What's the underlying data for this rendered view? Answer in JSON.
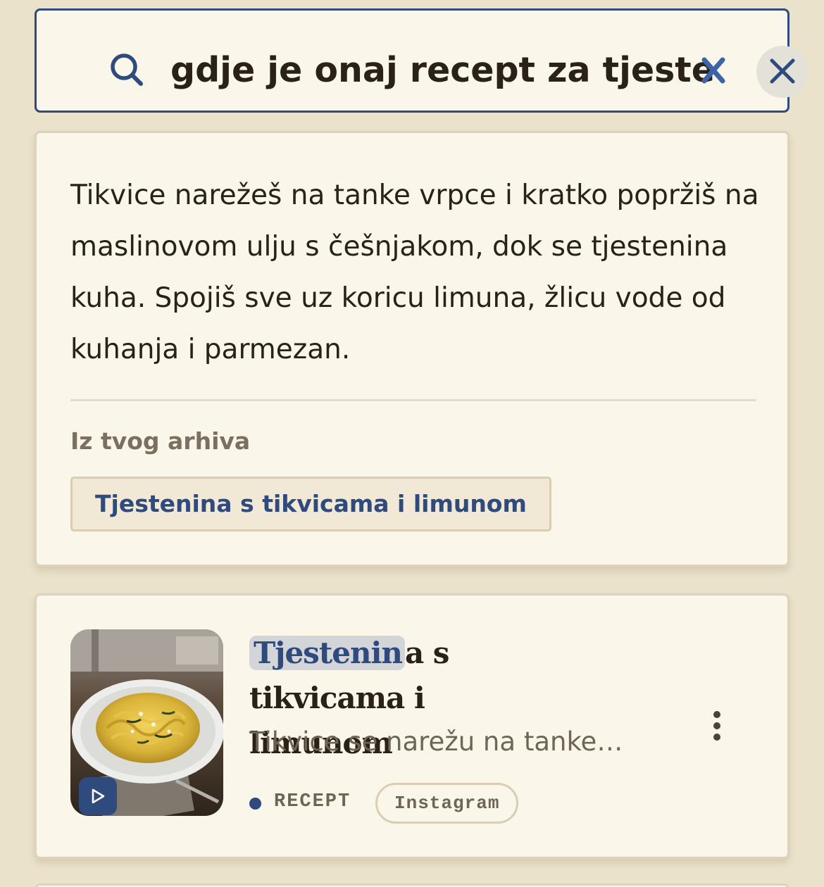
{
  "search": {
    "query": "gdje je onaj recept za tjestenin",
    "icon": "search-icon",
    "inline_clear_icon": "close-icon",
    "clear_button_icon": "close-icon"
  },
  "answer": {
    "text": "Tikvice narežeš na tanke vrpce i kratko popržiš na maslinovom ulju s češnjakom, dok se tjestenina kuha. Spojiš sve uz koricu limuna, žlicu vode od kuhanja i parmezan.",
    "archive_label": "Iz tvog arhiva",
    "archive_link": "Tjestenina s tikvicama i limunom"
  },
  "results": [
    {
      "title_highlight": "Tjestenin",
      "title_rest": "a s tikvicama i limunom",
      "snippet": "Tikvice se narežu na tanke…",
      "type": "RECEPT",
      "source": "Instagram",
      "thumbnail_icon": "play-icon",
      "more_icon": "more-vertical-icon"
    }
  ],
  "colors": {
    "background": "#ebe2cc",
    "card": "#faf6ea",
    "accent": "#2f4a7d",
    "text": "#2a2118",
    "muted": "#6f6555"
  }
}
